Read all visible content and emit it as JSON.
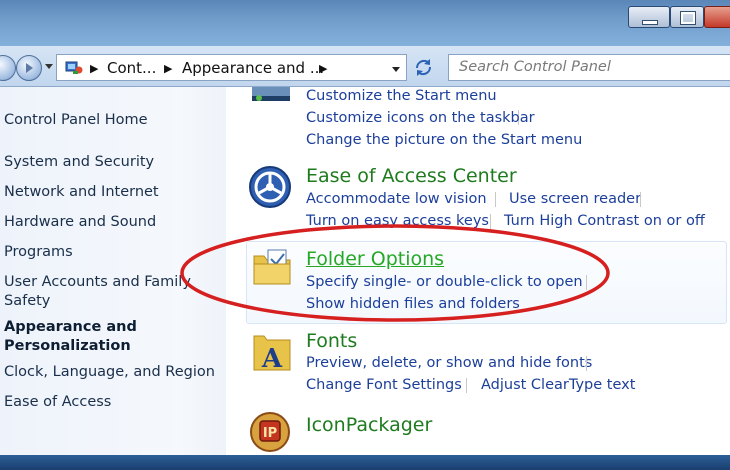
{
  "breadcrumb": {
    "items": [
      "Cont...",
      "Appearance and ..."
    ]
  },
  "search": {
    "placeholder": "Search Control Panel"
  },
  "sidebar": {
    "items": [
      {
        "label": "Control Panel Home"
      },
      {
        "label": "System and Security"
      },
      {
        "label": "Network and Internet"
      },
      {
        "label": "Hardware and Sound"
      },
      {
        "label": "Programs"
      },
      {
        "label": "User Accounts and Family",
        "label2": "Safety"
      },
      {
        "label": "Appearance and",
        "label2": "Personalization",
        "current": true
      },
      {
        "label": "Clock, Language, and Region"
      },
      {
        "label": "Ease of Access"
      }
    ]
  },
  "sections": {
    "taskbar": {
      "links": [
        "Customize the Start menu",
        "Customize icons on the taskbar",
        "Change the picture on the Start menu"
      ]
    },
    "ease_of_access": {
      "title": "Ease of Access Center",
      "links": [
        "Accommodate low vision",
        "Use screen reader",
        "Turn on easy access keys",
        "Turn High Contrast on or off"
      ]
    },
    "folder_options": {
      "title": "Folder Options",
      "links": [
        "Specify single- or double-click to open",
        "Show hidden files and folders"
      ]
    },
    "fonts": {
      "title": "Fonts",
      "links": [
        "Preview, delete, or show and hide fonts",
        "Change Font Settings",
        "Adjust ClearType text"
      ]
    },
    "iconpackager": {
      "title": "IconPackager"
    }
  },
  "icons": {
    "nav_back": "back-arrow-icon",
    "nav_forward": "forward-arrow-icon",
    "control_panel": "control-panel-icon",
    "refresh": "refresh-icon",
    "ease_of_access": "ease-of-access-icon",
    "folder_options": "folder-options-icon",
    "fonts": "fonts-icon",
    "iconpackager": "iconpackager-icon"
  },
  "colors": {
    "link": "#1c3f9a",
    "title_green": "#1e7b1e",
    "highlight_ellipse": "#d61f1f"
  }
}
